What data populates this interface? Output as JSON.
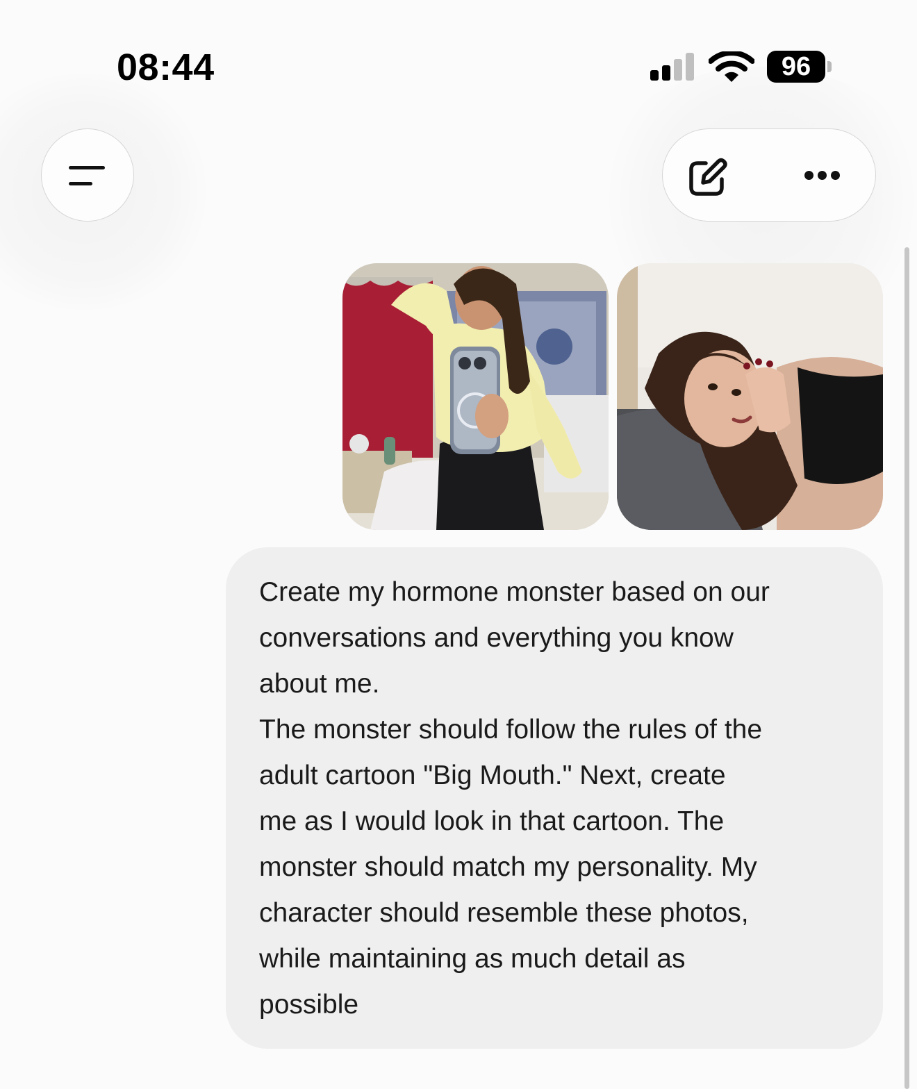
{
  "status_bar": {
    "time": "08:44",
    "battery": "96",
    "icons": [
      "cellular-signal-icon",
      "wifi-icon",
      "battery-icon"
    ]
  },
  "header": {
    "menu_icon": "menu-lines-icon",
    "new_chat_icon": "edit-pencil-icon",
    "more_icon": "more-dots-icon"
  },
  "message": {
    "attachments": [
      {
        "type": "image",
        "subject": "mirror selfie"
      },
      {
        "type": "image",
        "subject": "lying on bed selfie"
      }
    ],
    "lines": [
      "Create my hormone monster based on our",
      "conversations and everything you know",
      "about me.",
      "The monster should follow the rules of the",
      "adult cartoon \"Big Mouth.\" Next, create",
      "me as I would look in that cartoon. The",
      "monster should match my personality. My",
      "character should resemble these photos,",
      "while maintaining as much detail as",
      "possible"
    ]
  },
  "colors": {
    "background": "#fbfbfb",
    "bubble": "#efefef",
    "text": "#1a1a1a"
  }
}
